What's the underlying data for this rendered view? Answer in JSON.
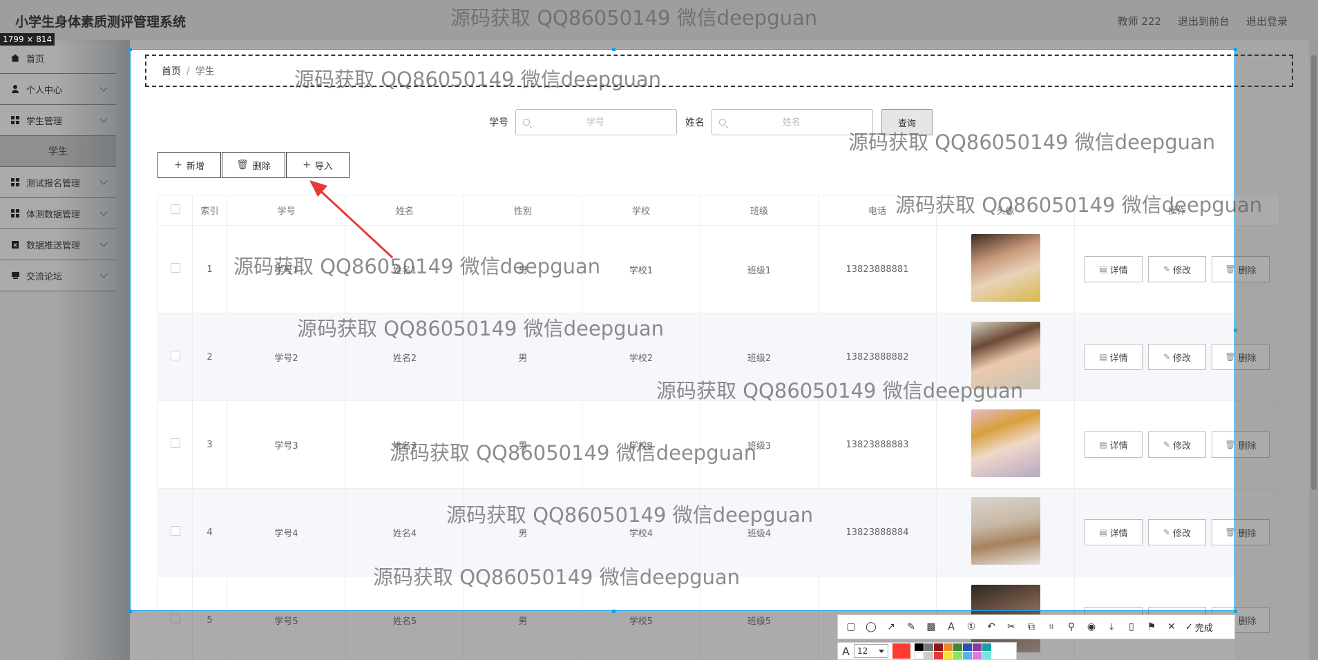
{
  "app": {
    "title": "小学生身体素质测评管理系统",
    "user_label": "教师 222",
    "front_link": "退出到前台",
    "logout_link": "退出登录"
  },
  "selection_size": "1799 × 814",
  "sidebar": {
    "items": [
      {
        "label": "首页",
        "icon": "home-icon"
      },
      {
        "label": "个人中心",
        "icon": "user-icon"
      },
      {
        "label": "学生管理",
        "icon": "grid-icon"
      },
      {
        "label": "学生",
        "icon": ""
      },
      {
        "label": "测试报名管理",
        "icon": "grid-icon"
      },
      {
        "label": "体测数据管理",
        "icon": "grid-icon"
      },
      {
        "label": "数据推送管理",
        "icon": "clipboard-icon"
      },
      {
        "label": "交流论坛",
        "icon": "chat-icon"
      }
    ]
  },
  "breadcrumb": {
    "home": "首页",
    "sep": "/",
    "current": "学生"
  },
  "search": {
    "id_label": "学号",
    "id_placeholder": "学号",
    "name_label": "姓名",
    "name_placeholder": "姓名",
    "query_button": "查询"
  },
  "actions": {
    "add": "新增",
    "delete": "删除",
    "import": "导入"
  },
  "table": {
    "columns": [
      "",
      "索引",
      "学号",
      "姓名",
      "性别",
      "学校",
      "班级",
      "电话",
      "头像",
      "操作"
    ],
    "rows": [
      {
        "index": "1",
        "id": "学号1",
        "name": "姓名1",
        "gender": "男",
        "school": "学校1",
        "class": "班级1",
        "phone": "13823888881"
      },
      {
        "index": "2",
        "id": "学号2",
        "name": "姓名2",
        "gender": "男",
        "school": "学校2",
        "class": "班级2",
        "phone": "13823888882"
      },
      {
        "index": "3",
        "id": "学号3",
        "name": "姓名3",
        "gender": "男",
        "school": "学校3",
        "class": "班级3",
        "phone": "13823888883"
      },
      {
        "index": "4",
        "id": "学号4",
        "name": "姓名4",
        "gender": "男",
        "school": "学校4",
        "class": "班级4",
        "phone": "13823888884"
      },
      {
        "index": "5",
        "id": "学号5",
        "name": "姓名5",
        "gender": "男",
        "school": "学校5",
        "class": "班级5",
        "phone": ""
      }
    ],
    "op_detail": "详情",
    "op_edit": "修改",
    "op_delete": "删除"
  },
  "watermark_text": "源码获取 QQ86050149 微信deepguan",
  "tool": {
    "done": "完成",
    "font_size": "12"
  },
  "colors": {
    "accent": "#1a9ee8",
    "annotation": "#e83838",
    "current_color": "#ff3b30"
  }
}
